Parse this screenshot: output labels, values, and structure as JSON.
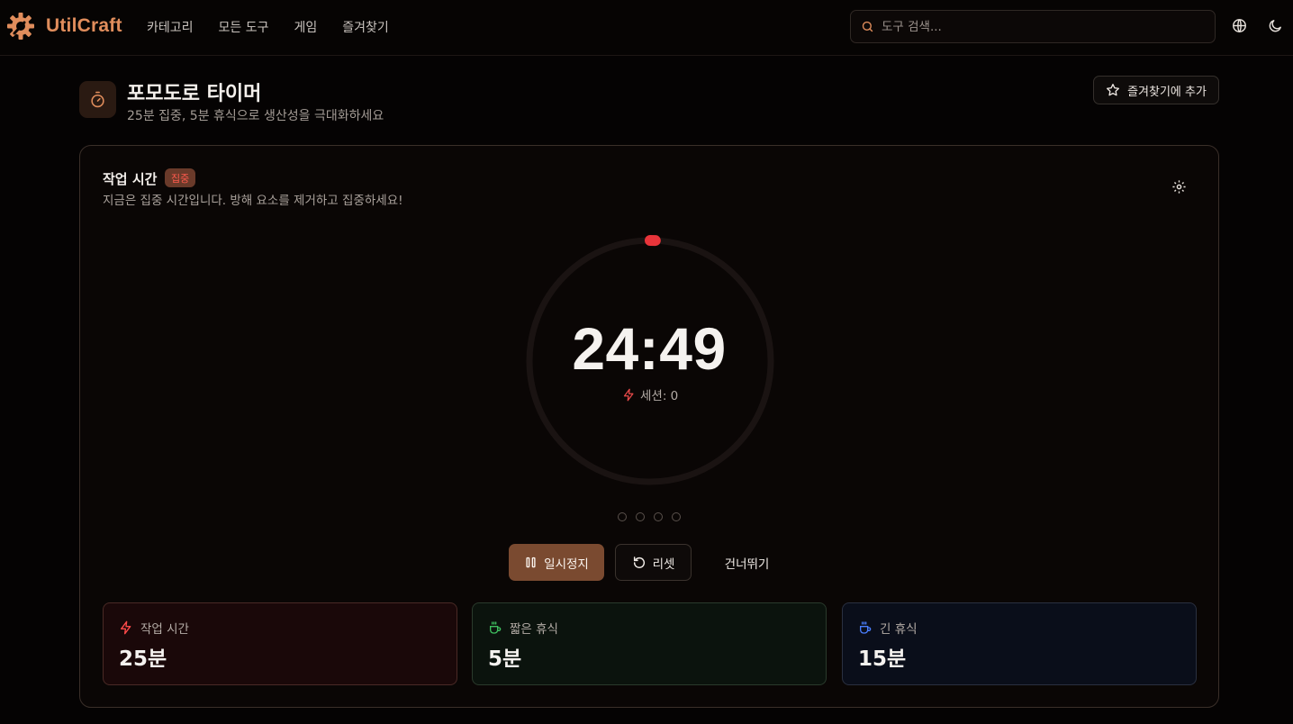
{
  "header": {
    "logo_text": "UtilCraft",
    "nav": [
      "카테고리",
      "모든 도구",
      "게임",
      "즐겨찾기"
    ],
    "search_placeholder": "도구 검색...",
    "icons": [
      "globe-icon",
      "moon-icon"
    ]
  },
  "tool": {
    "title": "포모도로 타이머",
    "subtitle": "25분 집중, 5분 휴식으로 생산성을 극대화하세요",
    "favorite_label": "즐겨찾기에 추가"
  },
  "timer": {
    "phase_title": "작업 시간",
    "phase_badge": "집중",
    "phase_description": "지금은 집중 시간입니다. 방해 요소를 제거하고 집중하세요!",
    "time_display": "24:49",
    "session_label": "세션: 0",
    "progress_fraction": 0.007,
    "session_dots": 4,
    "buttons": {
      "pause": "일시정지",
      "reset": "리셋",
      "skip": "건너뛰기"
    }
  },
  "stats": [
    {
      "label": "작업 시간",
      "value": "25분",
      "icon": "lightning-icon"
    },
    {
      "label": "짧은 휴식",
      "value": "5분",
      "icon": "coffee-icon"
    },
    {
      "label": "긴 휴식",
      "value": "15분",
      "icon": "coffee-icon"
    }
  ],
  "colors": {
    "accent": "#e08d5c",
    "progress": "#e8343a",
    "work": "#ff4a4a",
    "short_break": "#3fbf5f",
    "long_break": "#4a7fff"
  }
}
